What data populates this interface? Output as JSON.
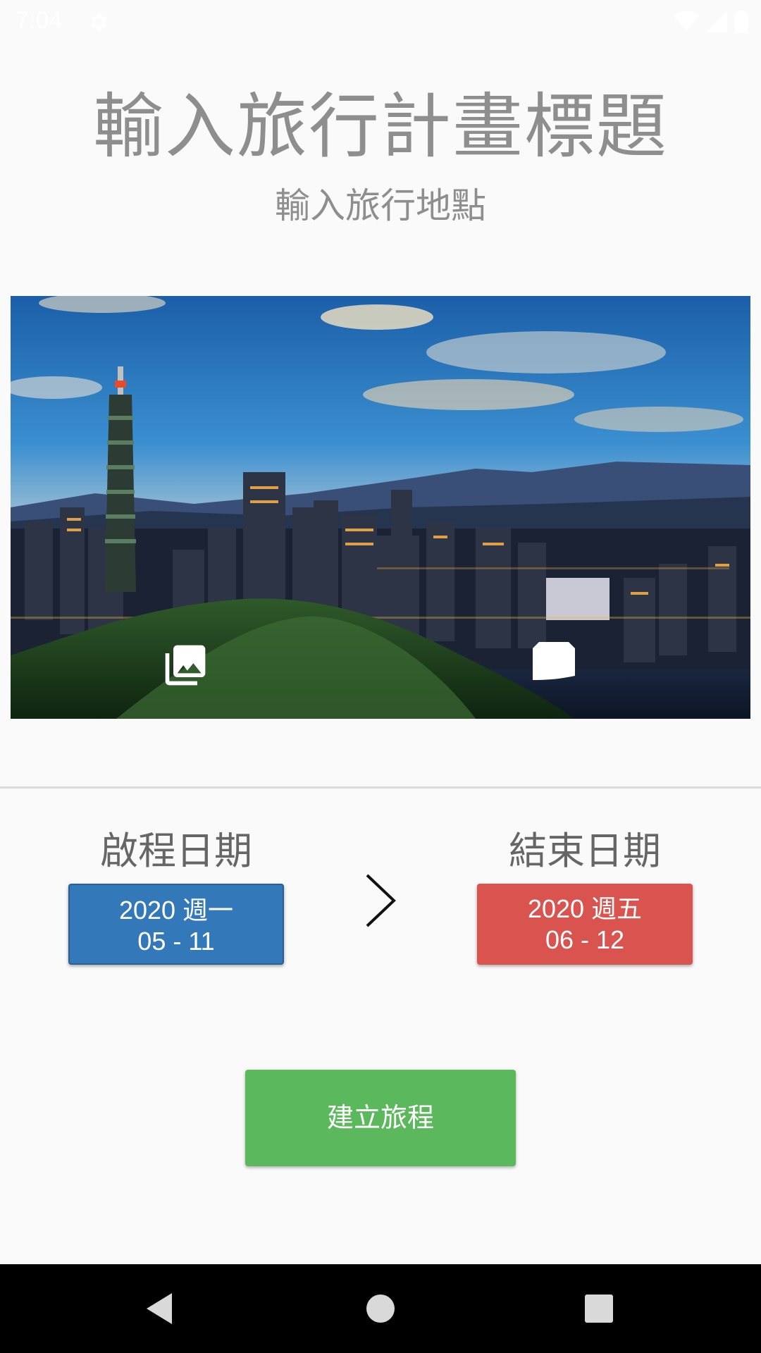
{
  "status_bar": {
    "time": "7:04",
    "icons": [
      "settings-gear-icon",
      "wifi-icon",
      "cellular-signal-icon",
      "battery-icon"
    ]
  },
  "trip": {
    "title_placeholder": "輸入旅行計畫標題",
    "location_placeholder": "輸入旅行地點"
  },
  "cover_photo": {
    "description_icon_left": "photo-library-icon",
    "description_icon_right": "camera-card-icon"
  },
  "dates": {
    "start_label": "啟程日期",
    "start_line1": "2020 週一",
    "start_line2": "05 - 11",
    "end_label": "結束日期",
    "end_line1": "2020 週五",
    "end_line2": "06 - 12",
    "separator_icon": "chevron-right-icon"
  },
  "actions": {
    "create_label": "建立旅程"
  },
  "colors": {
    "background": "#fafafa",
    "start_date": "#3378b9",
    "end_date": "#d9534f",
    "create_button": "#5cb85c",
    "title_text": "#8e8e8e",
    "nav_bar": "#000000"
  },
  "nav_bar": {
    "buttons": [
      "back-triangle-icon",
      "home-circle-icon",
      "recents-square-icon"
    ]
  }
}
